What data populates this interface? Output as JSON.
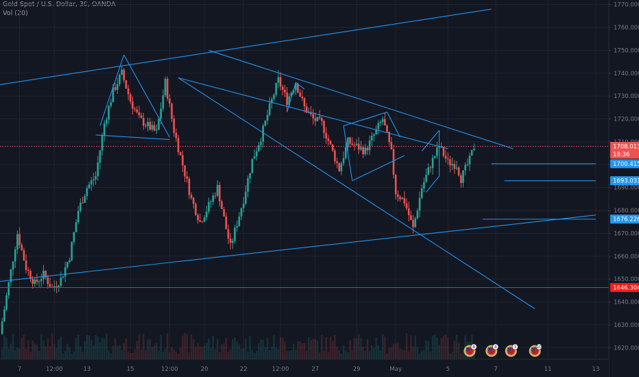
{
  "legend": {
    "instrument": "Gold Spot / U.S. Dollar, 30, OANDA",
    "indicator": "Vol (20)"
  },
  "colors": {
    "background": "#131722",
    "grid": "#1f2431",
    "up": "#26a69a",
    "down": "#ef5350",
    "trendline": "#2196f3",
    "price_line": "#ef5350",
    "support_line": "#ff1a1a"
  },
  "chart_data": {
    "type": "candlestick",
    "title": "Gold Spot / U.S. Dollar, 30, OANDA",
    "indicator": "Vol (20)",
    "ylim": [
      1615,
      1772
    ],
    "y_ticks": [
      1620,
      1630,
      1640,
      1650,
      1660,
      1670,
      1680,
      1690,
      1700,
      1710,
      1720,
      1730,
      1740,
      1750,
      1760,
      1770
    ],
    "y_tick_labels": [
      "1620.000",
      "1630.000",
      "1640.000",
      "1650.000",
      "1660.000",
      "1670.000",
      "1680.000",
      "1690.000",
      "1700.000",
      "1710.000",
      "1720.000",
      "1730.000",
      "1740.000",
      "1750.000",
      "1760.000",
      "1770.000"
    ],
    "x_ticks": [
      "7",
      "12:00",
      "13",
      "15",
      "12:00",
      "20",
      "22",
      "12:00",
      "27",
      "29",
      "May",
      "5",
      "7",
      "11",
      "13"
    ],
    "x_tick_slots": [
      4.5,
      12.5,
      20,
      30,
      39,
      47,
      56,
      64.5,
      72.5,
      82,
      91,
      103,
      114,
      126,
      137
    ],
    "slots": 140,
    "grid": true,
    "price_path": [
      [
        0,
        1626
      ],
      [
        2,
        1648
      ],
      [
        4,
        1670
      ],
      [
        6,
        1655
      ],
      [
        8,
        1648
      ],
      [
        10,
        1652
      ],
      [
        12,
        1646
      ],
      [
        14,
        1650
      ],
      [
        16,
        1660
      ],
      [
        18,
        1680
      ],
      [
        20,
        1690
      ],
      [
        22,
        1695
      ],
      [
        24,
        1718
      ],
      [
        26,
        1732
      ],
      [
        28,
        1740
      ],
      [
        30,
        1728
      ],
      [
        32,
        1720
      ],
      [
        34,
        1717
      ],
      [
        36,
        1714
      ],
      [
        38,
        1736
      ],
      [
        40,
        1715
      ],
      [
        42,
        1700
      ],
      [
        44,
        1685
      ],
      [
        46,
        1675
      ],
      [
        48,
        1682
      ],
      [
        50,
        1690
      ],
      [
        52,
        1672
      ],
      [
        53,
        1664
      ],
      [
        56,
        1685
      ],
      [
        58,
        1702
      ],
      [
        60,
        1712
      ],
      [
        62,
        1725
      ],
      [
        64,
        1737
      ],
      [
        66,
        1728
      ],
      [
        68,
        1736
      ],
      [
        70,
        1725
      ],
      [
        72,
        1720
      ],
      [
        74,
        1718
      ],
      [
        76,
        1708
      ],
      [
        78,
        1698
      ],
      [
        80,
        1710
      ],
      [
        82,
        1708
      ],
      [
        84,
        1706
      ],
      [
        86,
        1713
      ],
      [
        88,
        1720
      ],
      [
        90,
        1705
      ],
      [
        91,
        1688
      ],
      [
        93,
        1684
      ],
      [
        95,
        1672
      ],
      [
        97,
        1690
      ],
      [
        99,
        1700
      ],
      [
        101,
        1708
      ],
      [
        103,
        1701
      ],
      [
        105,
        1700
      ],
      [
        106,
        1694
      ],
      [
        108,
        1702
      ],
      [
        109,
        1708
      ]
    ],
    "lines": [
      {
        "name": "upper-channel",
        "points": [
          [
            0,
            1735
          ],
          [
            113,
            1768
          ]
        ]
      },
      {
        "name": "lower-channel",
        "points": [
          [
            0,
            1649
          ],
          [
            137,
            1678
          ]
        ]
      },
      {
        "name": "descending-resistance",
        "points": [
          [
            48,
            1750
          ],
          [
            118,
            1707
          ]
        ]
      },
      {
        "name": "wedge-upper",
        "points": [
          [
            41,
            1738
          ],
          [
            103,
            1707
          ]
        ]
      },
      {
        "name": "wedge-lower",
        "points": [
          [
            41,
            1738
          ],
          [
            123,
            1637
          ]
        ]
      },
      {
        "name": "triangle-left",
        "points": [
          [
            23,
            1717
          ],
          [
            28.5,
            1748
          ]
        ]
      },
      {
        "name": "triangle-right",
        "points": [
          [
            28.5,
            1748
          ],
          [
            39,
            1712
          ]
        ]
      },
      {
        "name": "triangle-base",
        "points": [
          [
            22,
            1713
          ],
          [
            39,
            1711
          ]
        ]
      },
      {
        "name": "hs-shoulder-1",
        "points": [
          [
            66,
            1723
          ],
          [
            68,
            1736
          ]
        ]
      },
      {
        "name": "hs-shoulder-2",
        "points": [
          [
            68,
            1736
          ],
          [
            70,
            1733
          ]
        ]
      },
      {
        "name": "flag-top",
        "points": [
          [
            79,
            1717
          ],
          [
            89,
            1723
          ]
        ]
      },
      {
        "name": "flag-bottom",
        "points": [
          [
            81,
            1693
          ],
          [
            93,
            1704
          ]
        ]
      },
      {
        "name": "flag-left",
        "points": [
          [
            79,
            1717
          ],
          [
            81,
            1693
          ]
        ]
      },
      {
        "name": "flag-right",
        "points": [
          [
            89,
            1723
          ],
          [
            92,
            1712
          ]
        ]
      },
      {
        "name": "pennant-top",
        "points": [
          [
            97,
            1706
          ],
          [
            101,
            1715
          ]
        ]
      },
      {
        "name": "pennant-bottom",
        "points": [
          [
            98,
            1688
          ],
          [
            101,
            1695
          ]
        ]
      },
      {
        "name": "pennant-right",
        "points": [
          [
            101,
            1715
          ],
          [
            101,
            1695
          ]
        ]
      },
      {
        "name": "level-1700",
        "points": [
          [
            113,
            1700.4
          ],
          [
            137,
            1700.4
          ]
        ]
      },
      {
        "name": "level-1693",
        "points": [
          [
            116,
            1693.0
          ],
          [
            137,
            1693.0
          ]
        ]
      },
      {
        "name": "level-1676",
        "points": [
          [
            111,
            1676.2
          ],
          [
            137,
            1676.2
          ]
        ]
      }
    ],
    "horizontal_lines": [
      {
        "name": "current-price",
        "value": 1708.013,
        "style": "dotted"
      },
      {
        "name": "support",
        "value": 1646.304,
        "style": "solid"
      }
    ],
    "price_tags": [
      {
        "value": 1708.013,
        "label": "1708.013",
        "bg": "#ef5350",
        "text": "#ffffff"
      },
      {
        "value": 1704.6,
        "label": "18:36",
        "bg": "#ef5350",
        "text": "#ffffff"
      },
      {
        "value": 1700.415,
        "label": "1700.415",
        "bg": "#2196f3",
        "text": "#ffffff"
      },
      {
        "value": 1693.031,
        "label": "1693.031",
        "bg": "#2196f3",
        "text": "#ffffff"
      },
      {
        "value": 1676.226,
        "label": "1676.226",
        "bg": "#2196f3",
        "text": "#ffffff"
      },
      {
        "value": 1646.304,
        "label": "1646.304",
        "bg": "#ff1a1a",
        "text": "#ffffff"
      }
    ],
    "events": [
      {
        "slot": 108,
        "count": "8"
      },
      {
        "slot": 113,
        "count": "4"
      },
      {
        "slot": 117.5,
        "count": "3"
      },
      {
        "slot": 123,
        "count": "10"
      }
    ]
  }
}
